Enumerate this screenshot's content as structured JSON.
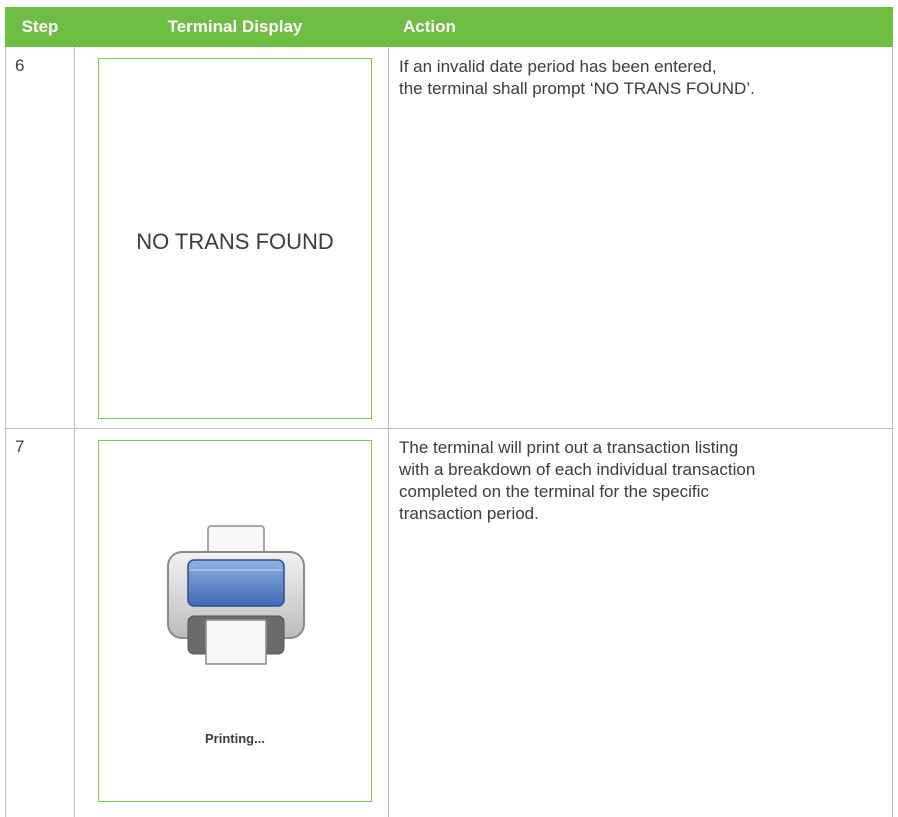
{
  "table": {
    "headers": {
      "step": "Step",
      "display": "Terminal Display",
      "action": "Action"
    },
    "rows": [
      {
        "step": "6",
        "display_text": "NO TRANS FOUND",
        "action_line1": "If an invalid date period has been entered,",
        "action_line2": "the terminal shall prompt ‘NO TRANS FOUND’."
      },
      {
        "step": "7",
        "display_icon": "printer-icon",
        "display_text": "Printing...",
        "action_line1": "The terminal will print out a transaction listing",
        "action_line2": "with a breakdown of each individual transaction",
        "action_line3": "completed on the terminal for the specific",
        "action_line4": "transaction period."
      }
    ]
  },
  "colors": {
    "header_bg": "#6fbe44",
    "header_text": "#ffffff",
    "display_border": "#7ccb4b",
    "grid_line": "#bdbdbd",
    "body_text": "#3c3c3c"
  }
}
